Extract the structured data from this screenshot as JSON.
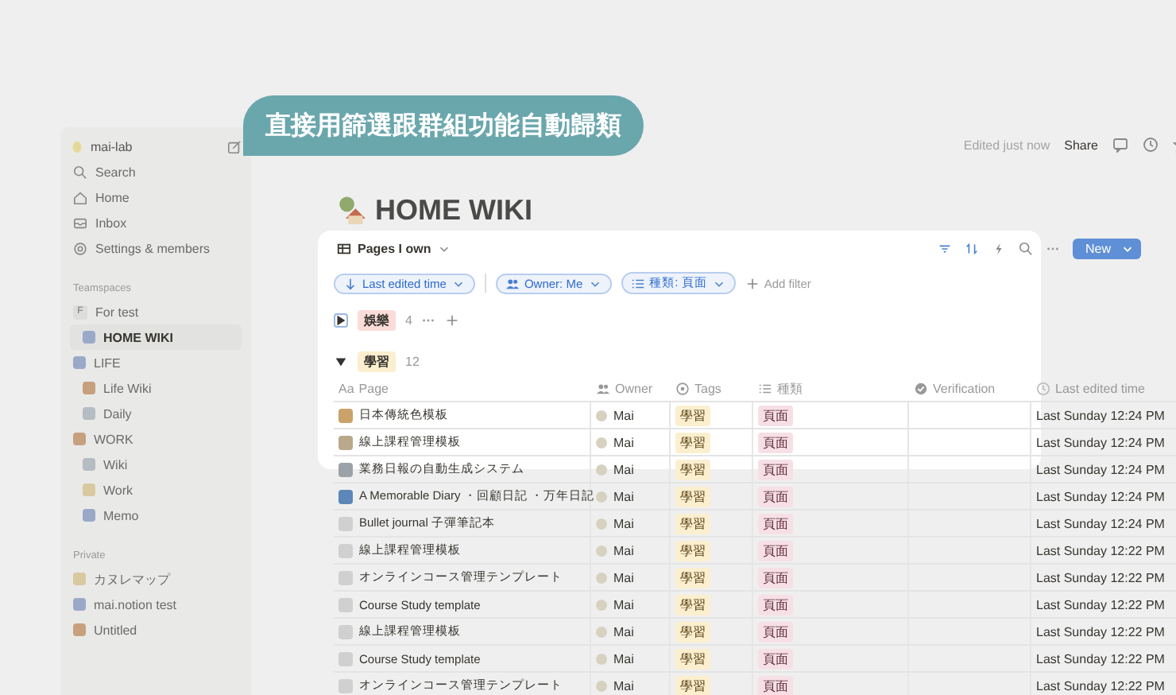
{
  "callout": {
    "text": "直接用篩選跟群組功能自動歸類"
  },
  "sidebar": {
    "workspace": "mai-lab",
    "nav": [
      {
        "kind": "search",
        "label": "Search"
      },
      {
        "kind": "home",
        "label": "Home"
      },
      {
        "kind": "inbox",
        "label": "Inbox"
      },
      {
        "kind": "settings",
        "label": "Settings & members"
      }
    ],
    "sections": [
      {
        "label": "Teamspaces",
        "items": [
          {
            "label": "For test",
            "badge": "F",
            "selected": false,
            "children": [
              {
                "label": "HOME WIKI",
                "selected": true
              }
            ]
          },
          {
            "label": "LIFE",
            "selected": false,
            "children": [
              {
                "label": "Life Wiki",
                "selected": false
              },
              {
                "label": "Daily",
                "selected": false
              }
            ]
          },
          {
            "label": "WORK",
            "selected": false,
            "children": [
              {
                "label": "Wiki",
                "selected": false
              },
              {
                "label": "Work",
                "selected": false
              },
              {
                "label": "Memo",
                "selected": false
              }
            ]
          }
        ]
      },
      {
        "label": "Private",
        "items": [
          {
            "label": "カヌレマップ",
            "selected": false
          },
          {
            "label": "mai.notion test",
            "selected": false
          },
          {
            "label": "Untitled",
            "selected": false
          }
        ]
      }
    ]
  },
  "topbar": {
    "edited": "Edited just now",
    "share": "Share"
  },
  "page": {
    "title": "HOME WIKI"
  },
  "database": {
    "view": "Pages I own",
    "new_button": "New",
    "filters": [
      {
        "kind": "sort",
        "label": "Last edited time"
      },
      {
        "kind": "people",
        "label": "Owner: Me"
      },
      {
        "kind": "list",
        "label": "種類: 頁面"
      }
    ],
    "add_filter": "Add filter",
    "groups": [
      {
        "tag": "娛樂",
        "color": "#fbdcd9",
        "count": "4",
        "expanded": false
      },
      {
        "tag": "學習",
        "color": "#fbefcf",
        "count": "12",
        "expanded": true
      }
    ],
    "columns": [
      {
        "kind": "title",
        "label": "Page",
        "prefix": "Aa"
      },
      {
        "kind": "person",
        "label": "Owner"
      },
      {
        "kind": "select",
        "label": "Tags"
      },
      {
        "kind": "list",
        "label": "種類"
      },
      {
        "kind": "verify",
        "label": "Verification"
      },
      {
        "kind": "time",
        "label": "Last edited time"
      }
    ],
    "rows": [
      {
        "page": "日本傳統色模板",
        "owner": "Mai",
        "tag": "學習",
        "type": "頁面",
        "edited": "Last Sunday 12:24 PM"
      },
      {
        "page": "線上課程管理模板",
        "owner": "Mai",
        "tag": "學習",
        "type": "頁面",
        "edited": "Last Sunday 12:24 PM"
      },
      {
        "page": "業務日報の自動生成システム",
        "owner": "Mai",
        "tag": "學習",
        "type": "頁面",
        "edited": "Last Sunday 12:24 PM"
      },
      {
        "page": "A Memorable Diary ・回顧日記 ・万年日記",
        "owner": "Mai",
        "tag": "學習",
        "type": "頁面",
        "edited": "Last Sunday 12:24 PM"
      },
      {
        "page": "Bullet journal 子彈筆記本",
        "owner": "Mai",
        "tag": "學習",
        "type": "頁面",
        "edited": "Last Sunday 12:24 PM"
      },
      {
        "page": "線上課程管理模板",
        "owner": "Mai",
        "tag": "學習",
        "type": "頁面",
        "edited": "Last Sunday 12:22 PM"
      },
      {
        "page": "オンラインコース管理テンプレート",
        "owner": "Mai",
        "tag": "學習",
        "type": "頁面",
        "edited": "Last Sunday 12:22 PM"
      },
      {
        "page": "Course Study template",
        "owner": "Mai",
        "tag": "學習",
        "type": "頁面",
        "edited": "Last Sunday 12:22 PM"
      },
      {
        "page": "線上課程管理模板",
        "owner": "Mai",
        "tag": "學習",
        "type": "頁面",
        "edited": "Last Sunday 12:22 PM"
      },
      {
        "page": "Course Study template",
        "owner": "Mai",
        "tag": "學習",
        "type": "頁面",
        "edited": "Last Sunday 12:22 PM"
      },
      {
        "page": "オンラインコース管理テンプレート",
        "owner": "Mai",
        "tag": "學習",
        "type": "頁面",
        "edited": "Last Sunday 12:22 PM"
      }
    ]
  }
}
